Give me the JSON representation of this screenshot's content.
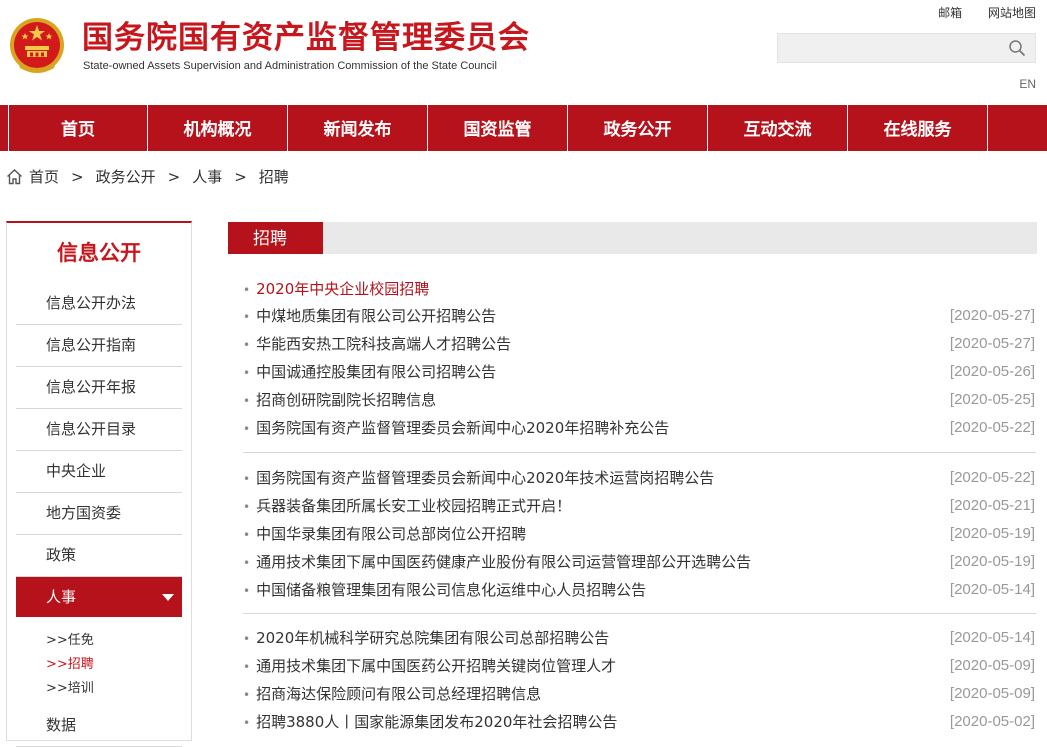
{
  "header": {
    "title_cn": "国务院国有资产监督管理委员会",
    "title_en": "State-owned Assets Supervision and Administration Commission of the State Council",
    "links": [
      "邮箱",
      "网站地图"
    ],
    "lang": "EN",
    "search": {
      "value": "",
      "placeholder": ""
    },
    "brand_color": "#b5121b"
  },
  "nav": [
    "首页",
    "机构概况",
    "新闻发布",
    "国资监管",
    "政务公开",
    "互动交流",
    "在线服务"
  ],
  "breadcrumb": {
    "items": [
      "首页",
      "政务公开",
      "人事",
      "招聘"
    ],
    "separator": ">"
  },
  "sidebar": {
    "title": "信息公开",
    "items": [
      "信息公开办法",
      "信息公开指南",
      "信息公开年报",
      "信息公开目录",
      "中央企业",
      "地方国资委",
      "政策"
    ],
    "active": "人事",
    "sub": [
      ">>任免",
      ">>招聘",
      ">>培训"
    ],
    "after": [
      "数据"
    ]
  },
  "main": {
    "tab": "招聘",
    "featured": "2020年中央企业校园招聘",
    "groups": [
      [
        {
          "title": "中煤地质集团有限公司公开招聘公告",
          "date": "[2020-05-27]"
        },
        {
          "title": "华能西安热工院科技高端人才招聘公告",
          "date": "[2020-05-27]"
        },
        {
          "title": "中国诚通控股集团有限公司招聘公告",
          "date": "[2020-05-26]"
        },
        {
          "title": "招商创研院副院长招聘信息",
          "date": "[2020-05-25]"
        },
        {
          "title": "国务院国有资产监督管理委员会新闻中心2020年招聘补充公告",
          "date": "[2020-05-22]"
        }
      ],
      [
        {
          "title": "国务院国有资产监督管理委员会新闻中心2020年技术运营岗招聘公告",
          "date": "[2020-05-22]"
        },
        {
          "title": "兵器装备集团所属长安工业校园招聘正式开启！",
          "date": "[2020-05-21]"
        },
        {
          "title": "中国华录集团有限公司总部岗位公开招聘",
          "date": "[2020-05-19]"
        },
        {
          "title": "通用技术集团下属中国医药健康产业股份有限公司运营管理部公开选聘公告",
          "date": "[2020-05-19]"
        },
        {
          "title": "中国储备粮管理集团有限公司信息化运维中心人员招聘公告",
          "date": "[2020-05-14]"
        }
      ],
      [
        {
          "title": "2020年机械科学研究总院集团有限公司总部招聘公告",
          "date": "[2020-05-14]"
        },
        {
          "title": "通用技术集团下属中国医药公开招聘关键岗位管理人才",
          "date": "[2020-05-09]"
        },
        {
          "title": "招商海达保险顾问有限公司总经理招聘信息",
          "date": "[2020-05-09]"
        },
        {
          "title": "招聘3880人丨国家能源集团发布2020年社会招聘公告",
          "date": "[2020-05-02]"
        }
      ]
    ]
  }
}
